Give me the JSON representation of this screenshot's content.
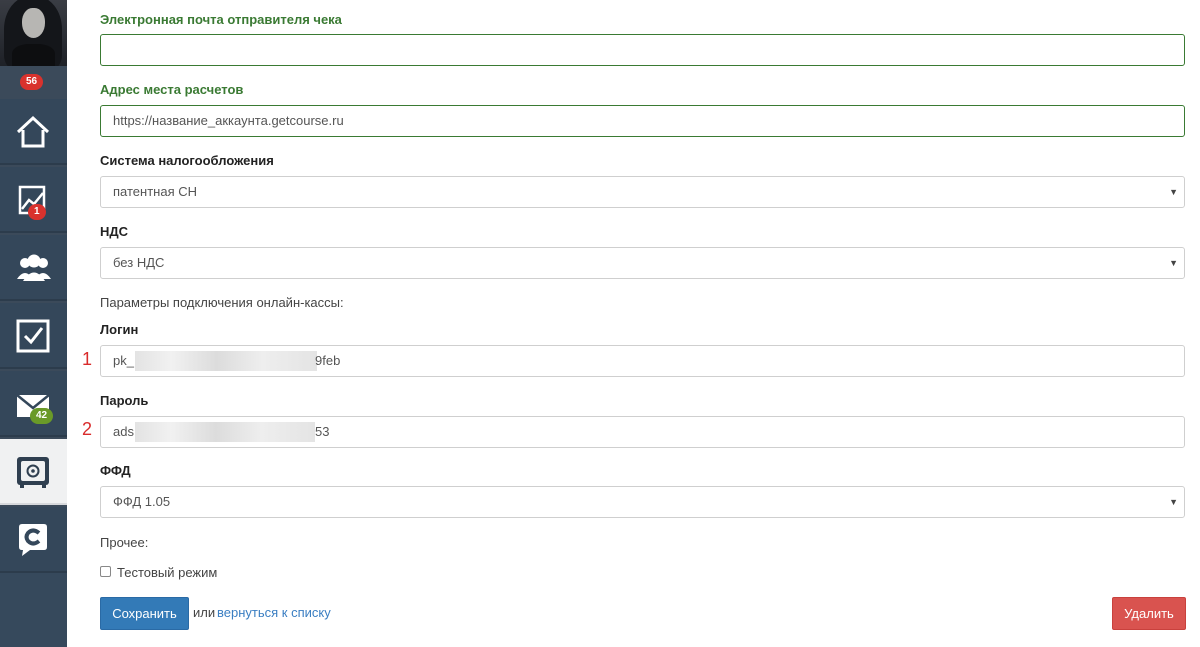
{
  "sidebar": {
    "notification_count": "56",
    "nav": {
      "home": {
        "icon": "home-icon"
      },
      "analytics": {
        "icon": "chart-icon",
        "badge": "1"
      },
      "users": {
        "icon": "users-icon"
      },
      "tasks": {
        "icon": "checkbox-icon"
      },
      "messages": {
        "icon": "mail-icon",
        "badge": "42"
      },
      "settings": {
        "icon": "safe-icon"
      },
      "getcourse": {
        "icon": "getcourse-logo-icon"
      }
    }
  },
  "form": {
    "sender_email": {
      "label": "Электронная почта отправителя чека",
      "value": ""
    },
    "settlement_address": {
      "label": "Адрес места расчетов",
      "value": "https://название_аккаунта.getcourse.ru"
    },
    "tax_system": {
      "label": "Система налогообложения",
      "value": "патентная СН"
    },
    "vat": {
      "label": "НДС",
      "value": "без НДС"
    },
    "connection_params": "Параметры подключения онлайн-кассы:",
    "login": {
      "label": "Логин",
      "marker": "1",
      "value_start": "pk_",
      "value_end": "9feb"
    },
    "password": {
      "label": "Пароль",
      "marker": "2",
      "value_start": "ads",
      "value_end": "53"
    },
    "ffd": {
      "label": "ФФД",
      "value": "ФФД 1.05"
    },
    "other": "Прочее:",
    "test_mode": {
      "label": "Тестовый режим",
      "checked": false
    },
    "save_label": "Сохранить",
    "or_text": "или",
    "back_link": "вернуться к списку",
    "delete_label": "Удалить"
  },
  "colors": {
    "sidebar_bg": "#34475a",
    "primary": "#337ab7",
    "danger": "#d9534f",
    "success_label": "#3a7a33",
    "badge_red": "#d9322d",
    "badge_green": "#6a9a28"
  }
}
